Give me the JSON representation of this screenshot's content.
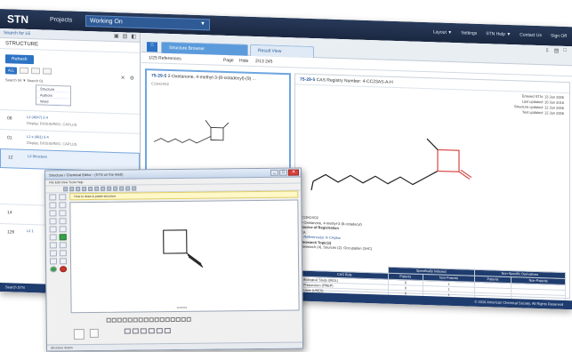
{
  "header": {
    "logo": "STN",
    "projects_label": "Projects",
    "project_selector": "Working On",
    "links": [
      "Layout ▼",
      "Settings",
      "STN Help ▼",
      "Contact Us",
      "Sign Off"
    ]
  },
  "left_pane": {
    "head_label": "Search for L6",
    "query_title": "STRUCTURE",
    "search_button": "Refresh",
    "filter_pill": "ALL",
    "select_label": "Search 04 ▼ Search 01",
    "dropdown_options": [
      "Structure",
      "Authors",
      "Word"
    ],
    "query_rows": [
      {
        "num": "08",
        "l1": "L2 (4647) 0.4",
        "l2": "Display, BIOSIS/REG, CAPLUS"
      },
      {
        "num": "01",
        "l1": "L1 s (481) 0.4",
        "l2": "Display, BIOSIS/REG, CAPLUS"
      },
      {
        "num": "12",
        "l1": "L3 Structure",
        "l2": ""
      },
      {
        "num": "14",
        "l1": "",
        "l2": ""
      },
      {
        "num": "126",
        "l1": "L2 1",
        "l2": ""
      }
    ]
  },
  "main": {
    "tabs": [
      "Structure Browser",
      "Result View"
    ],
    "toolbar_items": [
      "1/25 References",
      "Page",
      "Hide",
      "2/13 245"
    ],
    "result_card": {
      "id": "75-29-5",
      "desc": "2-Oxetanone, 4-methyl-3-(8-octadecyl)-(9) ...",
      "sub": "C13H24O2"
    },
    "detail": {
      "id": "75-29-5",
      "title": "CAS Registry Number: 4-CC23AS-A-H",
      "dates": [
        "Entered STN: 13 Jan 2006",
        "Last updated: 10 Jan 2016",
        "Structure updated: 12 Jan 2006",
        "Text updated: 12 Jan 2006"
      ],
      "formula": "C13H24O2",
      "name": "2-Oxetanone, 4-methyl-3-(8-octadecyl)",
      "source_label": "Source of Registration",
      "source_value": "CA",
      "refs_label": "1 Reference(s) In CAplus",
      "research_label": "Research Topic(s)",
      "research_value": "Research (4), Sources (2), Occupation (1HC)",
      "table": {
        "group1": "Specifically Indexed",
        "group2": "Non-Specific Derivatives",
        "cols": [
          "CAS Role",
          "Patents",
          "Non-Patents",
          "Patents",
          "Non-Patents"
        ],
        "rows": [
          [
            "Biological Study (BIOL)",
            "0",
            "1",
            "",
            ""
          ],
          [
            "Preparation (PREP)",
            "0",
            "1",
            "",
            ""
          ],
          [
            "Uses (USES)",
            "0",
            "1",
            "",
            ""
          ]
        ]
      }
    }
  },
  "footer": {
    "left": "Search STN",
    "right": "© 2016 American Chemical Society, All Rights Reserved"
  },
  "editor": {
    "title": "Structure / Chemical Editor - (STN on the Web)",
    "menu": "File  Edit  View  Tools  Help",
    "warning": "How to draw & paste structure",
    "canvas_caption": "structure",
    "status": "Structure drawn"
  }
}
